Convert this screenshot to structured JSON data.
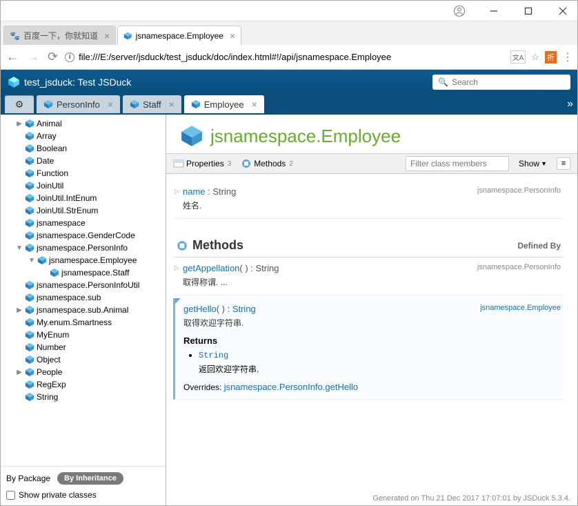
{
  "os": {
    "user_icon": "user",
    "min": "—",
    "max": "▢",
    "close": "✕"
  },
  "browser": {
    "tabs": [
      {
        "label": "百度一下，你就知道"
      },
      {
        "label": "jsnamespace.Employee"
      }
    ],
    "url": "file:///E:/server/jsduck/test_jsduck/doc/index.html#!/api/jsnamespace.Employee",
    "ext_badge": "折"
  },
  "header": {
    "title": "test_jsduck: Test JSDuck",
    "search_placeholder": "Search"
  },
  "doctabs": [
    {
      "label": "PersonInfo"
    },
    {
      "label": "Staff"
    },
    {
      "label": "Employee",
      "active": true
    }
  ],
  "tree": [
    {
      "label": "Animal",
      "arrow": "closed",
      "indent": 1
    },
    {
      "label": "Array",
      "arrow": "none",
      "indent": 1
    },
    {
      "label": "Boolean",
      "arrow": "none",
      "indent": 1
    },
    {
      "label": "Date",
      "arrow": "none",
      "indent": 1
    },
    {
      "label": "Function",
      "arrow": "none",
      "indent": 1
    },
    {
      "label": "JoinUtil",
      "arrow": "none",
      "indent": 1
    },
    {
      "label": "JoinUtil.IntEnum",
      "arrow": "none",
      "indent": 1
    },
    {
      "label": "JoinUtil.StrEnum",
      "arrow": "none",
      "indent": 1
    },
    {
      "label": "jsnamespace",
      "arrow": "none",
      "indent": 1
    },
    {
      "label": "jsnamespace.GenderCode",
      "arrow": "none",
      "indent": 1
    },
    {
      "label": "jsnamespace.PersonInfo",
      "arrow": "open",
      "indent": 1
    },
    {
      "label": "jsnamespace.Employee",
      "arrow": "open",
      "indent": 2
    },
    {
      "label": "jsnamespace.Staff",
      "arrow": "none",
      "indent": 3
    },
    {
      "label": "jsnamespace.PersonInfoUtil",
      "arrow": "none",
      "indent": 1
    },
    {
      "label": "jsnamespace.sub",
      "arrow": "none",
      "indent": 1
    },
    {
      "label": "jsnamespace.sub.Animal",
      "arrow": "closed",
      "indent": 1
    },
    {
      "label": "My.enum.Smartness",
      "arrow": "none",
      "indent": 1
    },
    {
      "label": "MyEnum",
      "arrow": "none",
      "indent": 1
    },
    {
      "label": "Number",
      "arrow": "none",
      "indent": 1
    },
    {
      "label": "Object",
      "arrow": "none",
      "indent": 1
    },
    {
      "label": "People",
      "arrow": "closed",
      "indent": 1
    },
    {
      "label": "RegExp",
      "arrow": "none",
      "indent": 1
    },
    {
      "label": "String",
      "arrow": "none",
      "indent": 1
    }
  ],
  "sidebar": {
    "by_package": "By Package",
    "by_inheritance": "By Inheritance",
    "show_private": "Show private classes"
  },
  "class": {
    "title": "jsnamespace.Employee",
    "toolbar": {
      "properties": "Properties",
      "prop_count": "3",
      "methods": "Methods",
      "meth_count": "2",
      "filter_placeholder": "Filter class members",
      "show": "Show"
    }
  },
  "property": {
    "name": "name",
    "sep": " : ",
    "type": "String",
    "defined": "jsnamespace.PersonInfo",
    "desc": "姓名."
  },
  "methods_section": {
    "title": "Methods",
    "defined_by": "Defined By"
  },
  "method1": {
    "name": "getAppellation",
    "sig": "( ) : ",
    "ret": "String",
    "defined": "jsnamespace.PersonInfo",
    "desc": "取得称谓. ..."
  },
  "method2": {
    "name": "getHello",
    "sig": "( ) : ",
    "ret": "String",
    "defined": "jsnamespace.Employee",
    "desc": "取得欢迎字符串.",
    "returns_label": "Returns",
    "returns_type": "String",
    "returns_desc": "返回欢迎字符串.",
    "overrides_label": "Overrides: ",
    "overrides_link": "jsnamespace.PersonInfo.getHello"
  },
  "footer": "Generated on Thu 21 Dec 2017 17:07:01 by JSDuck 5.3.4."
}
